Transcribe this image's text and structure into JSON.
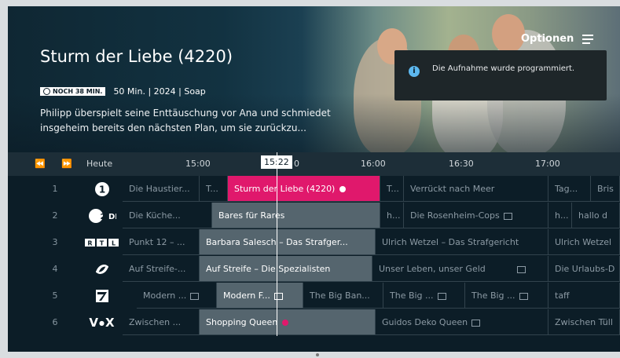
{
  "header": {
    "options_label": "Optionen",
    "title": "Sturm der Liebe (4220)",
    "badge": "NOCH 38 MIN.",
    "meta": "50 Min. | 2024 | Soap",
    "description": "Philipp überspielt seine Enttäuschung vor Ana und schmiedet insgeheim bereits den nächsten Plan, um sie zurückzu..."
  },
  "toast": {
    "message": "Die Aufnahme wurde programmiert."
  },
  "timebar": {
    "today": "Heute",
    "t1500": "15:00",
    "now": "15:22",
    "now_suffix": "0",
    "t1600": "16:00",
    "t1630": "16:30",
    "t1700": "17:00"
  },
  "colors": {
    "selected": "#e0186c",
    "record": "#e0186c"
  },
  "rows": [
    {
      "num": "1",
      "logo": "ARD",
      "cells": [
        "Die Haustier...",
        "T...",
        "Sturm der Liebe (4220)",
        "T...",
        "Verrückt nach Meer",
        "Tag...",
        "Bris"
      ]
    },
    {
      "num": "2",
      "logo": "ZDF",
      "cells": [
        "Die Küche...",
        "Bares für Rares",
        "h...",
        "Die Rosenheim-Cops",
        "h...",
        "hallo d"
      ]
    },
    {
      "num": "3",
      "logo": "RTL",
      "cells": [
        "Punkt 12 – ...",
        "Barbara Salesch – Das Strafger...",
        "Ulrich Wetzel – Das Strafgericht",
        "Ulrich Wetzel"
      ]
    },
    {
      "num": "4",
      "logo": "Sport1",
      "cells": [
        "Auf Streife-...",
        "Auf Streife – Die Spezialisten",
        "Unser Leben, unser Geld",
        "Die Urlaubs-D"
      ]
    },
    {
      "num": "5",
      "logo": "7",
      "cells": [
        "Modern ...",
        "Modern F...",
        "The Big Ban...",
        "The Big ...",
        "The Big ...",
        "taff"
      ]
    },
    {
      "num": "6",
      "logo": "VOX",
      "cells": [
        "Zwischen ...",
        "Shopping Queen",
        "Guidos Deko Queen",
        "Zwischen Tüll"
      ]
    }
  ]
}
